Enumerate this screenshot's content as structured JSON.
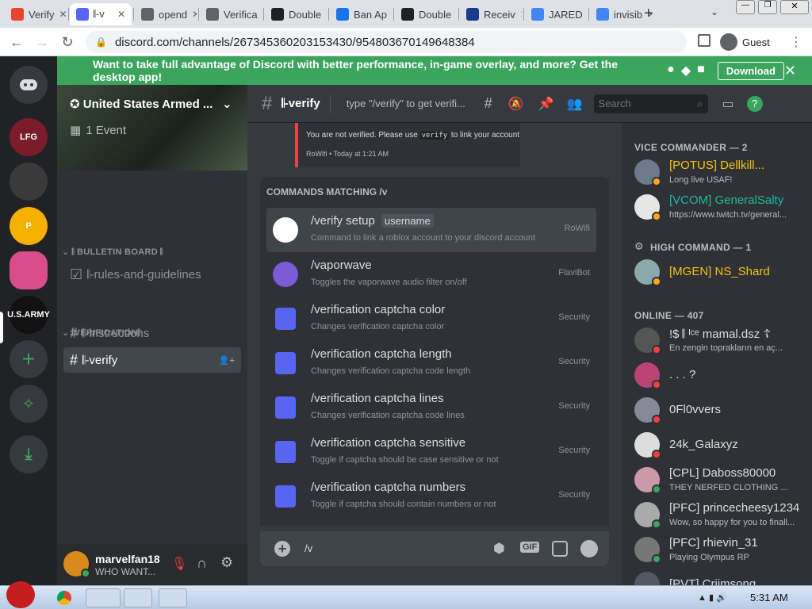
{
  "browser": {
    "tabs": [
      {
        "label": "Verify",
        "icon": "gmail-icon"
      },
      {
        "label": "𝄃-v",
        "icon": "discord-favicon",
        "active": true
      },
      {
        "label": "opend",
        "icon": "globe-icon"
      },
      {
        "label": "Verifica",
        "icon": "doc-icon"
      },
      {
        "label": "Double",
        "icon": "circle-icon"
      },
      {
        "label": "Ban Ap",
        "icon": "diamond-icon"
      },
      {
        "label": "Double",
        "icon": "circle-icon"
      },
      {
        "label": "Receiv",
        "icon": "mail-icon"
      },
      {
        "label": "JARED",
        "icon": "google-icon"
      },
      {
        "label": "invisib",
        "icon": "google-icon"
      }
    ],
    "url": "discord.com/channels/267345360203153430/954803670149648384",
    "profile_label": "Guest"
  },
  "banner": {
    "text": "Want to take full advantage of Discord with better performance, in-game overlay, and more? Get the desktop app!",
    "download_label": "Download"
  },
  "servers": [
    {
      "label": "LFG",
      "color": "#7a1c2a"
    },
    {
      "label": "",
      "color": "#3a3a3a"
    },
    {
      "label": "P",
      "color": "#f5b000"
    },
    {
      "label": "",
      "color": "#d94d8c"
    },
    {
      "label": "U.S.ARMY",
      "color": "#111111"
    }
  ],
  "server": {
    "name": "United States Armed ..."
  },
  "sidebar": {
    "event_label": "1 Event",
    "categories": [
      {
        "label": "𝄃 BULLETIN BOARD 𝄃",
        "channels": [
          "𝄃-rules-and-guidelines"
        ]
      },
      {
        "label": "𝄃VERIFICATION𝄃",
        "channels": [
          "𝄃-instructions",
          "𝄃-verify"
        ]
      }
    ]
  },
  "user": {
    "name": "marvelfan18",
    "status": "WHO WANT..."
  },
  "header": {
    "channel": "𝄃-verify",
    "topic": "type \"/verify\" to get verifi...",
    "search_placeholder": "Search"
  },
  "message": {
    "text": "You are not verified. Please use",
    "code": "verify",
    "text2": "to link your account",
    "footer": "RoWifi",
    "time": "Today at 1:21 AM"
  },
  "commands": {
    "title": "COMMANDS MATCHING /v",
    "items": [
      {
        "name": "/verify setup",
        "option": "username",
        "desc": "Command to link a roblox account to your discord account",
        "bot": "RoWifi",
        "icon_color": "#000000"
      },
      {
        "name": "/vaporwave",
        "desc": "Toggles the vaporwave audio filter on/off",
        "bot": "FlaviBot",
        "icon_color": "#7b5bd6"
      },
      {
        "name": "/verification captcha color",
        "desc": "Changes verification captcha color",
        "bot": "Security",
        "icon_color": "#5865f2"
      },
      {
        "name": "/verification captcha length",
        "desc": "Changes verification captcha code length",
        "bot": "Security",
        "icon_color": "#5865f2"
      },
      {
        "name": "/verification captcha lines",
        "desc": "Changes verification captcha code lines",
        "bot": "Security",
        "icon_color": "#5865f2"
      },
      {
        "name": "/verification captcha sensitive",
        "desc": "Toggle if captcha should be case sensitive or not",
        "bot": "Security",
        "icon_color": "#5865f2"
      },
      {
        "name": "/verification captcha numbers",
        "desc": "Toggle if captcha should contain numbers or not",
        "bot": "Security",
        "icon_color": "#5865f2"
      }
    ]
  },
  "composer": {
    "value": "/v"
  },
  "members": {
    "groups": [
      {
        "label": "VICE COMMANDER — 2",
        "members": [
          {
            "name": "[POTUS] Dellkill...",
            "status": "Long live USAF!",
            "color": "#f1c40f"
          },
          {
            "name": "[VCOM] GeneralSalty",
            "status": "https://www.twitch.tv/general...",
            "color": "#1abc9c"
          }
        ]
      },
      {
        "label": "HIGH COMMAND — 1",
        "members": [
          {
            "name": "[MGEN] NS_Shard",
            "status": "",
            "color": "#f1c40f"
          }
        ]
      },
      {
        "label": "ONLINE — 407",
        "members": [
          {
            "name": "!$ 𝄃 ᴵᶜᵉ mamal.dsz ☦",
            "status": "En zengin toprakların en aç...",
            "color": "#dcddde"
          },
          {
            "name": ". . . ?",
            "status": "",
            "color": "#dcddde"
          },
          {
            "name": "0Fl0vvers",
            "status": "",
            "color": "#dcddde"
          },
          {
            "name": "24k_Galaxyz",
            "status": "",
            "color": "#dcddde"
          },
          {
            "name": "[CPL] Daboss80000",
            "status": "THEY NERFED CLOTHING ...",
            "color": "#dcddde"
          },
          {
            "name": "[PFC] princecheesy1234",
            "status": "Wow, so happy for you to finall...",
            "color": "#dcddde"
          },
          {
            "name": "[PFC] rhievin_31",
            "status": "Playing Olympus RP",
            "color": "#dcddde"
          },
          {
            "name": "[PVT] Criimsong",
            "status": "",
            "color": "#dcddde"
          }
        ]
      }
    ]
  },
  "taskbar": {
    "time": "5:31 AM"
  }
}
